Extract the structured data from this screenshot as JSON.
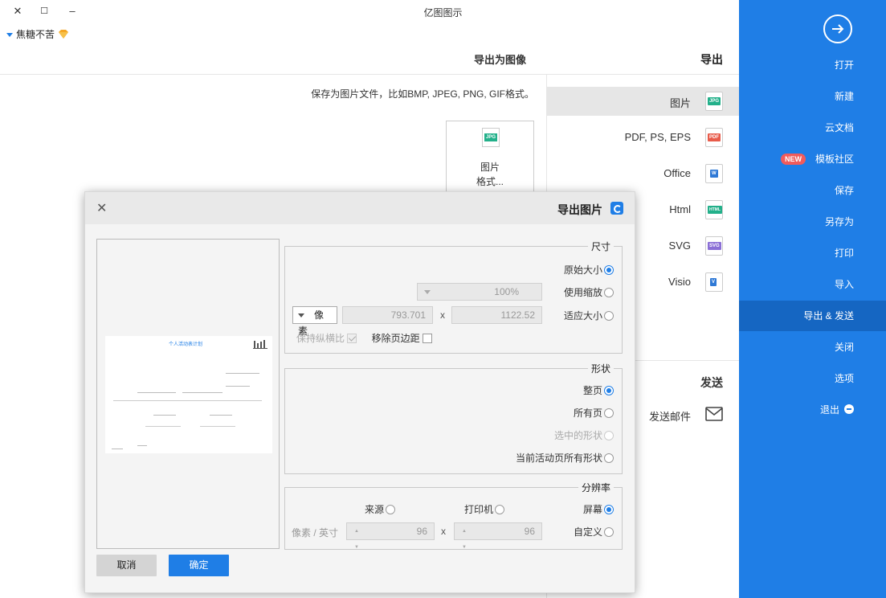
{
  "window": {
    "title": "亿图图示",
    "close": "✕",
    "maximize": "☐",
    "minimize": "–",
    "user_label": "焦糖不苦"
  },
  "sidebar": {
    "items": [
      {
        "label": "打开"
      },
      {
        "label": "新建"
      },
      {
        "label": "云文档"
      },
      {
        "label": "模板社区",
        "badge": "NEW"
      },
      {
        "label": "保存"
      },
      {
        "label": "另存为"
      },
      {
        "label": "打印"
      },
      {
        "label": "导入"
      },
      {
        "label": "导出 & 发送",
        "active": true
      },
      {
        "label": "关闭"
      },
      {
        "label": "选项"
      },
      {
        "label": "退出"
      }
    ],
    "color": "#1f7ee6"
  },
  "export_list": {
    "heading": "导出",
    "items": [
      {
        "label": "图片",
        "icon": "JPG",
        "icon_color": "#23b08a",
        "selected": true
      },
      {
        "label": "PDF, PS, EPS",
        "icon": "PDF",
        "icon_color": "#e85b4a"
      },
      {
        "label": "Office",
        "icon": "W",
        "icon_color": "#2f79d6"
      },
      {
        "label": "Html",
        "icon": "HTML",
        "icon_color": "#23b08a"
      },
      {
        "label": "SVG",
        "icon": "SVG",
        "icon_color": "#8b6fd6"
      },
      {
        "label": "Visio",
        "icon": "V",
        "icon_color": "#2f79d6"
      }
    ],
    "send_heading": "发送",
    "send_mail_label": "发送邮件"
  },
  "main": {
    "heading": "导出为图像",
    "description": "保存为图片文件，比如BMP, JPEG, PNG, GIF格式。",
    "card_icon": "JPG",
    "card_line1": "图片",
    "card_line2": "格式..."
  },
  "dialog": {
    "title": "导出图片",
    "close": "✕",
    "preview": {
      "doc_title": "个人活动表计划"
    },
    "size_group": {
      "title": "尺寸",
      "original": "原始大小",
      "use_zoom": "使用缩放",
      "zoom_value": "100%",
      "fit_size": "适应大小",
      "width": "1122.52",
      "height": "793.701",
      "unit": "像素",
      "x": "x",
      "remove_margin": "移除页边距",
      "keep_ratio": "保持纵横比"
    },
    "shape_group": {
      "title": "形状",
      "whole_page": "整页",
      "all_pages": "所有页",
      "selected_shapes": "选中的形状",
      "current_page_shapes": "当前活动页所有形状"
    },
    "resolution_group": {
      "title": "分辨率",
      "screen": "屏幕",
      "printer": "打印机",
      "source": "来源",
      "custom": "自定义",
      "res_x": "96",
      "res_y": "96",
      "x": "x",
      "unit": "像素 / 英寸"
    },
    "ok": "确定",
    "cancel": "取消"
  }
}
